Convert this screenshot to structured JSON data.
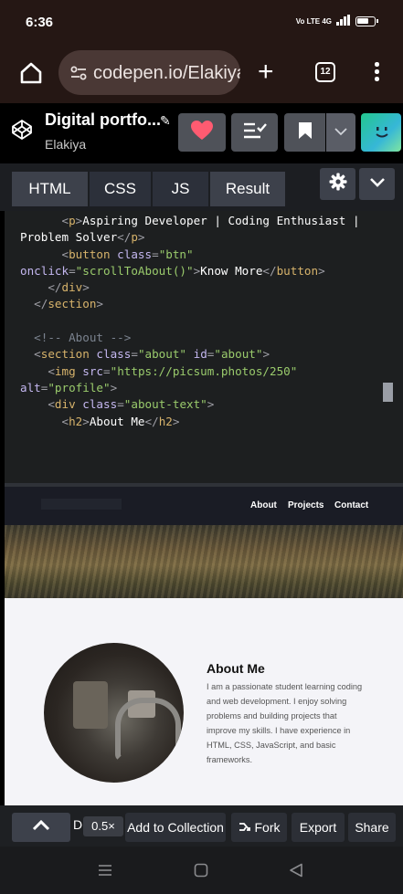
{
  "status_bar": {
    "time": "6:36",
    "signal_text": "Vo LTE 4G"
  },
  "browser": {
    "url": "codepen.io/Elakiya",
    "tab_count": "12"
  },
  "pen": {
    "title": "Digital portfo...",
    "author": "Elakiya"
  },
  "editor_tabs": [
    {
      "label": "HTML"
    },
    {
      "label": "CSS"
    },
    {
      "label": "JS"
    },
    {
      "label": "Result"
    }
  ],
  "preview": {
    "nav_links": [
      "About",
      "Projects",
      "Contact"
    ],
    "about_title": "About Me",
    "about_text": "I am a passionate student learning coding and web development. I enjoy solving problems and building projects that improve my skills. I have experience in HTML, CSS, JavaScript, and basic frameworks."
  },
  "bottom_bar": {
    "d_label": "D",
    "zoom": "0.5×",
    "add_to_collection": "Add to Collection",
    "fork": "Fork",
    "export": "Export",
    "share": "Share"
  },
  "colors": {
    "browser_bg": "#251714",
    "codepen_bg": "#000000",
    "editor_bg": "#1d1f20",
    "tag": "#d7b36b",
    "attribute": "#c4b7f0",
    "string": "#9acb6c",
    "comment": "#7b838f",
    "heart": "#ff5b71"
  }
}
